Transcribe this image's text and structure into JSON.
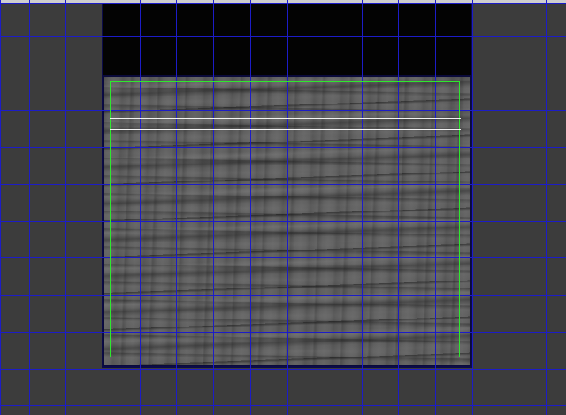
{
  "editor": {
    "grid_line_color": "#1c1cc8",
    "background_color": "#3c3c3c",
    "selection_color": "#2ee82e",
    "guide_line_color": "#f2f2f2",
    "empty_region_color": "#030303",
    "texture_name": "stone-wall-texture"
  }
}
